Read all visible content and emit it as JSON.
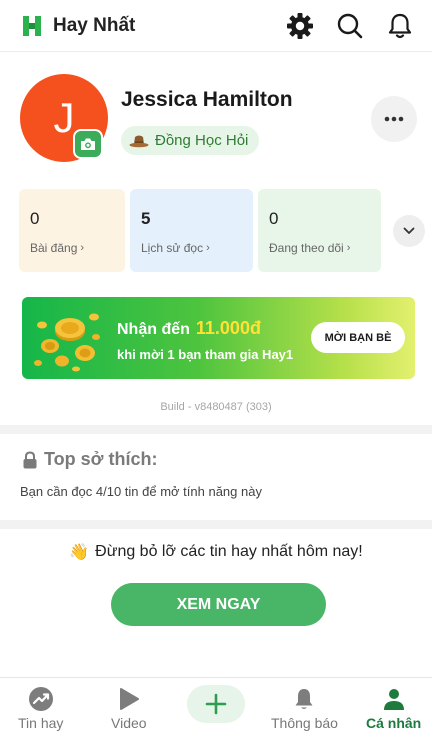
{
  "app": {
    "title": "Hay Nhất",
    "brand_color": "#2bb24c",
    "icons": [
      "gear-icon",
      "search-icon",
      "bell-icon"
    ]
  },
  "profile": {
    "avatar_letter": "J",
    "avatar_color": "#f4511e",
    "name": "Jessica Hamilton",
    "rank": "Đồng Học Hỏi",
    "rank_icon": "hat-icon"
  },
  "stats": [
    {
      "value": "0",
      "label": "Bài đăng",
      "color": "#fdf3e3"
    },
    {
      "value": "5",
      "label": "Lịch sử đọc",
      "color": "#e4f0fb"
    },
    {
      "value": "0",
      "label": "Đang theo dõi",
      "color": "#e8f5e9"
    }
  ],
  "banner": {
    "line1": "Nhận đến",
    "amount": "11.000đ",
    "line2": "khi mời 1 bạn tham gia Hay1",
    "button": "MỜI BẠN BÈ"
  },
  "build": "Build - v8480487 (303)",
  "hobbies": {
    "title": "Top sở thích:",
    "description": "Bạn cần đọc 4/10 tin để mở tính năng này"
  },
  "promo": {
    "emoji": "👋",
    "text": "Đừng bỏ lỡ các tin hay nhất hôm nay!",
    "button": "XEM NGAY"
  },
  "nav": {
    "items": [
      {
        "label": "Tin hay",
        "icon": "trending-icon"
      },
      {
        "label": "Video",
        "icon": "play-icon"
      },
      {
        "label": "Thông báo",
        "icon": "bell-icon"
      },
      {
        "label": "Cá nhân",
        "icon": "person-icon",
        "active": true
      }
    ],
    "active_color": "#1f7a3e"
  }
}
